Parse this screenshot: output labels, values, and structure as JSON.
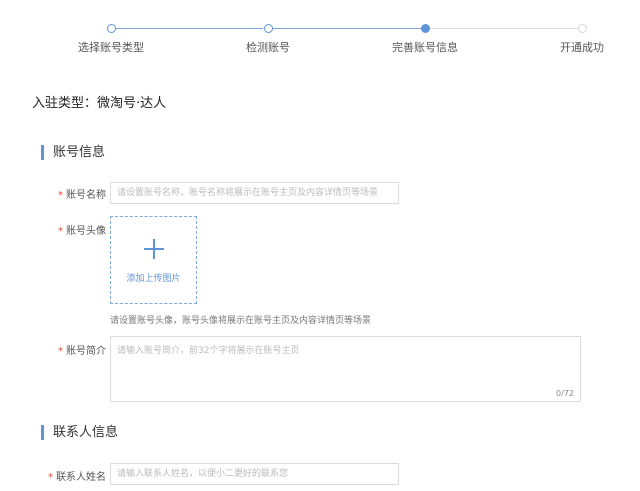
{
  "steps": [
    {
      "label": "选择账号类型",
      "state": "done"
    },
    {
      "label": "检测账号",
      "state": "done"
    },
    {
      "label": "完善账号信息",
      "state": "active"
    },
    {
      "label": "开通成功",
      "state": "todo"
    }
  ],
  "entry_type": "入驻类型：微淘号·达人",
  "sections": {
    "account": "账号信息",
    "contact": "联系人信息"
  },
  "fields": {
    "account_name": {
      "label": "账号名称",
      "placeholder": "请设置账号名称，账号名称将展示在账号主页及内容详情页等场景"
    },
    "avatar": {
      "label": "账号头像",
      "upload_text": "添加上传图片",
      "hint": "请设置账号头像，账号头像将展示在账号主页及内容详情页等场景"
    },
    "bio": {
      "label": "账号简介",
      "placeholder": "请输入账号简介，前32个字将展示在账号主页",
      "counter": "0/72"
    },
    "contact_name": {
      "label": "联系人姓名",
      "placeholder": "请输入联系人姓名，以便小二更好的联系您"
    }
  },
  "required_mark": "*",
  "colors": {
    "accent": "#5f95d8",
    "required": "#e24c3c"
  }
}
